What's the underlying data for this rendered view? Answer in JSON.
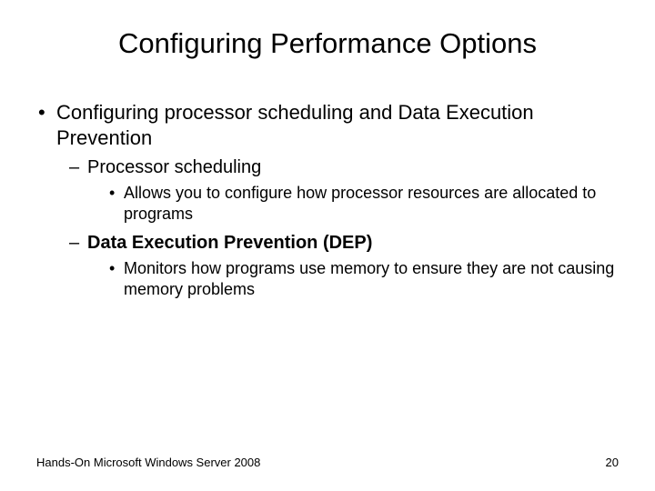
{
  "title": "Configuring Performance Options",
  "bullets": {
    "l1_0": "Configuring processor scheduling and Data Execution Prevention",
    "l2_0": "Processor scheduling",
    "l3_0": "Allows you to configure how processor resources are allocated to programs",
    "l2_1": "Data Execution Prevention (DEP)",
    "l3_1": "Monitors how programs use memory to ensure they are not causing memory problems"
  },
  "footer": {
    "left": "Hands-On Microsoft Windows Server 2008",
    "right": "20"
  }
}
